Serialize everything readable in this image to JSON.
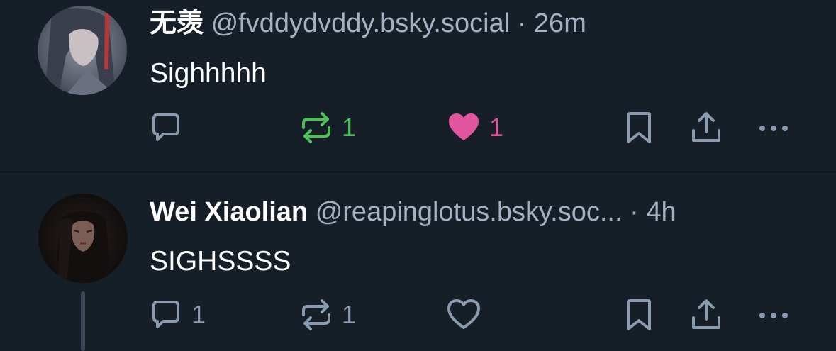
{
  "posts": [
    {
      "author_name": "无羡",
      "handle": "@fvddydvddy.bsky.social",
      "separator": "·",
      "time": "26m",
      "text": "Sighhhhh",
      "reply_count": "",
      "repost_count": "1",
      "like_count": "1",
      "reposted": true,
      "liked": true
    },
    {
      "author_name": "Wei Xiaolian",
      "handle": "@reapinglotus.bsky.soc...",
      "separator": "·",
      "time": "4h",
      "text": "SIGHSSSS",
      "reply_count": "1",
      "repost_count": "1",
      "like_count": "",
      "reposted": false,
      "liked": false
    }
  ],
  "colors": {
    "background": "#161e27",
    "muted": "#a3b1c2",
    "icon": "#8a9bb0",
    "repost_active": "#4cc15a",
    "like_active": "#e0559d",
    "divider": "#2e3946"
  },
  "icons": {
    "reply": "speech-bubble-icon",
    "repost": "repost-arrows-icon",
    "like": "heart-icon",
    "bookmark": "bookmark-icon",
    "share": "share-upload-icon",
    "more": "ellipsis-icon"
  }
}
